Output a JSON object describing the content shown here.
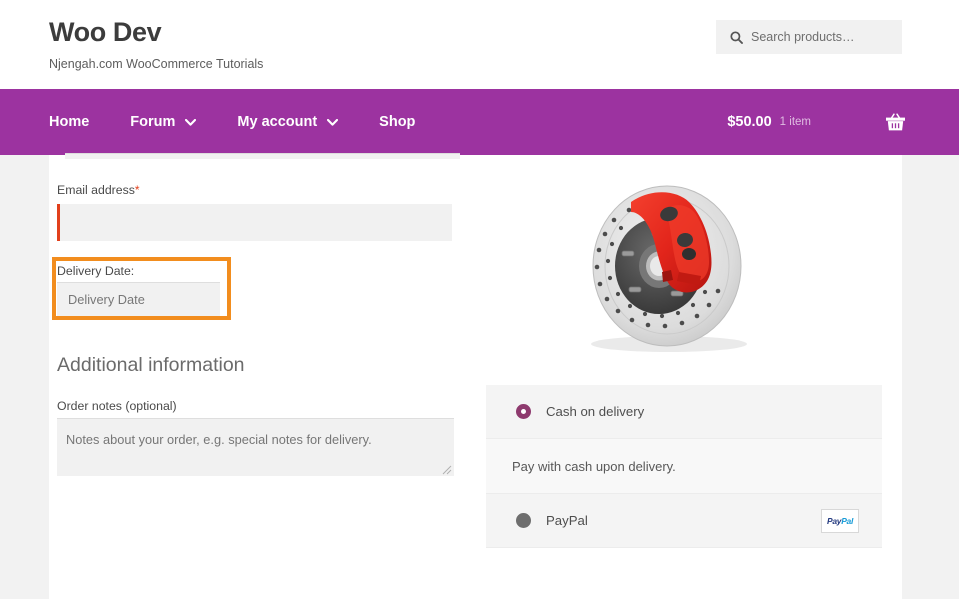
{
  "header": {
    "site_title": "Woo Dev",
    "tagline": "Njengah.com WooCommerce Tutorials",
    "search": {
      "placeholder": "Search products…",
      "icon": "search-icon"
    }
  },
  "nav": {
    "items": [
      {
        "label": "Home",
        "has_dropdown": false
      },
      {
        "label": "Forum",
        "has_dropdown": true
      },
      {
        "label": "My account",
        "has_dropdown": true
      },
      {
        "label": "Shop",
        "has_dropdown": false
      }
    ],
    "cart": {
      "total": "$50.00",
      "count": "1 item",
      "icon": "shopping-basket-icon"
    },
    "background_color": "#9c33a0"
  },
  "checkout": {
    "email": {
      "label": "Email address",
      "required_marker": "*",
      "value": ""
    },
    "delivery_date": {
      "label": "Delivery Date:",
      "placeholder": "Delivery Date",
      "value": "",
      "highlight_color": "#f28d1e"
    },
    "additional_information": {
      "heading": "Additional information",
      "order_notes_label": "Order notes (optional)",
      "order_notes_placeholder": "Notes about your order, e.g. special notes for delivery.",
      "order_notes_value": ""
    }
  },
  "order_review": {
    "product_image_alt": "brake-disc-with-red-caliper",
    "payment_methods": [
      {
        "label": "Cash on delivery",
        "selected": true,
        "description": "Pay with cash upon delivery."
      },
      {
        "label": "PayPal",
        "selected": false,
        "logo_text_a": "Pay",
        "logo_text_b": "Pal"
      }
    ]
  }
}
